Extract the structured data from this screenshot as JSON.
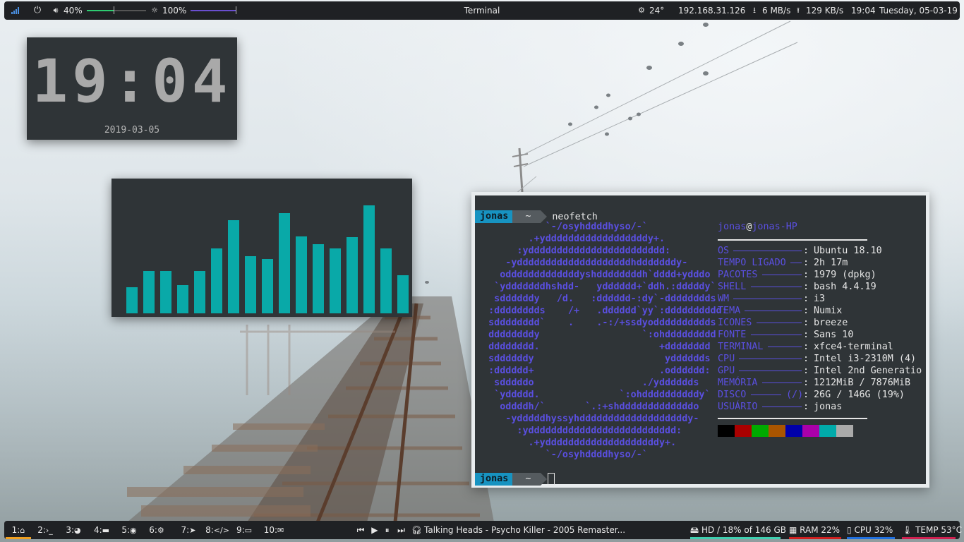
{
  "topbar": {
    "volume": "40%",
    "brightness": "100%",
    "window_title": "Terminal",
    "weather": "24°",
    "ip": "192.168.31.126",
    "download": "6 MB/s",
    "upload": "129 KB/s",
    "time": "19:04",
    "date": "Tuesday, 05-03-19"
  },
  "clock": {
    "time": "19:04",
    "date": "2019-03-05"
  },
  "visualizer": {
    "levels": [
      0.26,
      0.42,
      0.42,
      0.28,
      0.42,
      0.65,
      0.93,
      0.57,
      0.54,
      1.0,
      0.77,
      0.69,
      0.65,
      0.76,
      1.08,
      0.65,
      0.38
    ]
  },
  "terminal": {
    "prompt_user": "jonas",
    "prompt_dir": "~",
    "command": "neofetch",
    "ascii": [
      "            `-/osyhddddhyso/-`",
      "         .+yddddddddddddddddddy+.",
      "       :ydddddddddddddddddddddddd:",
      "     -yddddddddddddddddddddhdddddddy-",
      "    odddddddddddddyshddddddddh`dddd+ydddo",
      "   `ydddddddhshdd-   ydddddd+`ddh.:dddddy`",
      "   sddddddy   /d.   :dddddd-:dy`-dddddddds",
      "  :dddddddds    /+   .dddddd`yy`:dddddddddd:",
      "  sdddddddd`    .    .-:/+ssdyodddddddddds",
      "  ddddddddy                  `:ohddddddddd",
      "  dddddddd.                     +dddddddd",
      "  sddddddy                       ydddddds",
      "  :dddddd+                      .odddddd:",
      "   sdddddo                   ./ydddddds",
      "   `yddddd.              `:ohddddddddddy`",
      "    oddddh/`       `.:+shdddddddddddddo",
      "     -ydddddhyssyhdddddddddddddddddddy-",
      "       :ydddddddddddddddddddddddddd:",
      "         .+yddddddddddddddddddddy+.",
      "            `-/osyhddddhyso/-`"
    ],
    "info_user": "jonas",
    "info_host": "jonas-HP",
    "info": [
      {
        "key": "OS",
        "val": "Ubuntu 18.10"
      },
      {
        "key": "TEMPO LIGADO",
        "val": "2h 17m"
      },
      {
        "key": "PACOTES",
        "val": "1979 (dpkg)"
      },
      {
        "key": "SHELL",
        "val": "bash 4.4.19"
      },
      {
        "key": "WM",
        "val": "i3"
      },
      {
        "key": "TEMA",
        "val": "Numix"
      },
      {
        "key": "ICONES",
        "val": "breeze"
      },
      {
        "key": "FONTE",
        "val": "Sans 10"
      },
      {
        "key": "TERMINAL",
        "val": "xfce4-terminal"
      },
      {
        "key": "CPU",
        "val": "Intel i3-2310M (4)"
      },
      {
        "key": "GPU",
        "val": "Intel 2nd Generatio"
      },
      {
        "key": "MEMÓRIA",
        "val": "1212MiB / 7876MiB"
      },
      {
        "key": "DISCO",
        "extra": "(/)",
        "val": "26G / 146G (19%)"
      },
      {
        "key": "USUÁRIO",
        "val": "jonas"
      }
    ],
    "palette": [
      "#000000",
      "#aa0000",
      "#00aa00",
      "#aa5500",
      "#0000aa",
      "#aa00aa",
      "#00aaaa",
      "#aaaaaa"
    ],
    "prompt2_user": "jonas",
    "prompt2_dir": "~"
  },
  "bottombar": {
    "workspaces": [
      {
        "num": "1:",
        "icon": "home-icon",
        "active": true
      },
      {
        "num": "2:",
        "icon": "terminal-icon"
      },
      {
        "num": "3:",
        "icon": "firefox-icon"
      },
      {
        "num": "4:",
        "icon": "folder-icon"
      },
      {
        "num": "5:",
        "icon": "spotify-icon"
      },
      {
        "num": "6:",
        "icon": "steam-icon"
      },
      {
        "num": "7:",
        "icon": "telegram-icon"
      },
      {
        "num": "8:",
        "icon": "code-icon"
      },
      {
        "num": "9:",
        "icon": "chat-icon"
      },
      {
        "num": "10:",
        "icon": "mail-open-icon"
      }
    ],
    "now_playing": "Talking Heads - Psycho Killer - 2005 Remaster...",
    "disk": "HD / 18% of 146 GB",
    "ram": "RAM 22%",
    "cpu": "CPU 32%",
    "temp": "TEMP 53°C",
    "colors": {
      "disk": "#3fd0b0",
      "ram": "#d02020",
      "cpu": "#2070e0",
      "temp": "#d02050",
      "active_ws": "#f0a020"
    }
  }
}
